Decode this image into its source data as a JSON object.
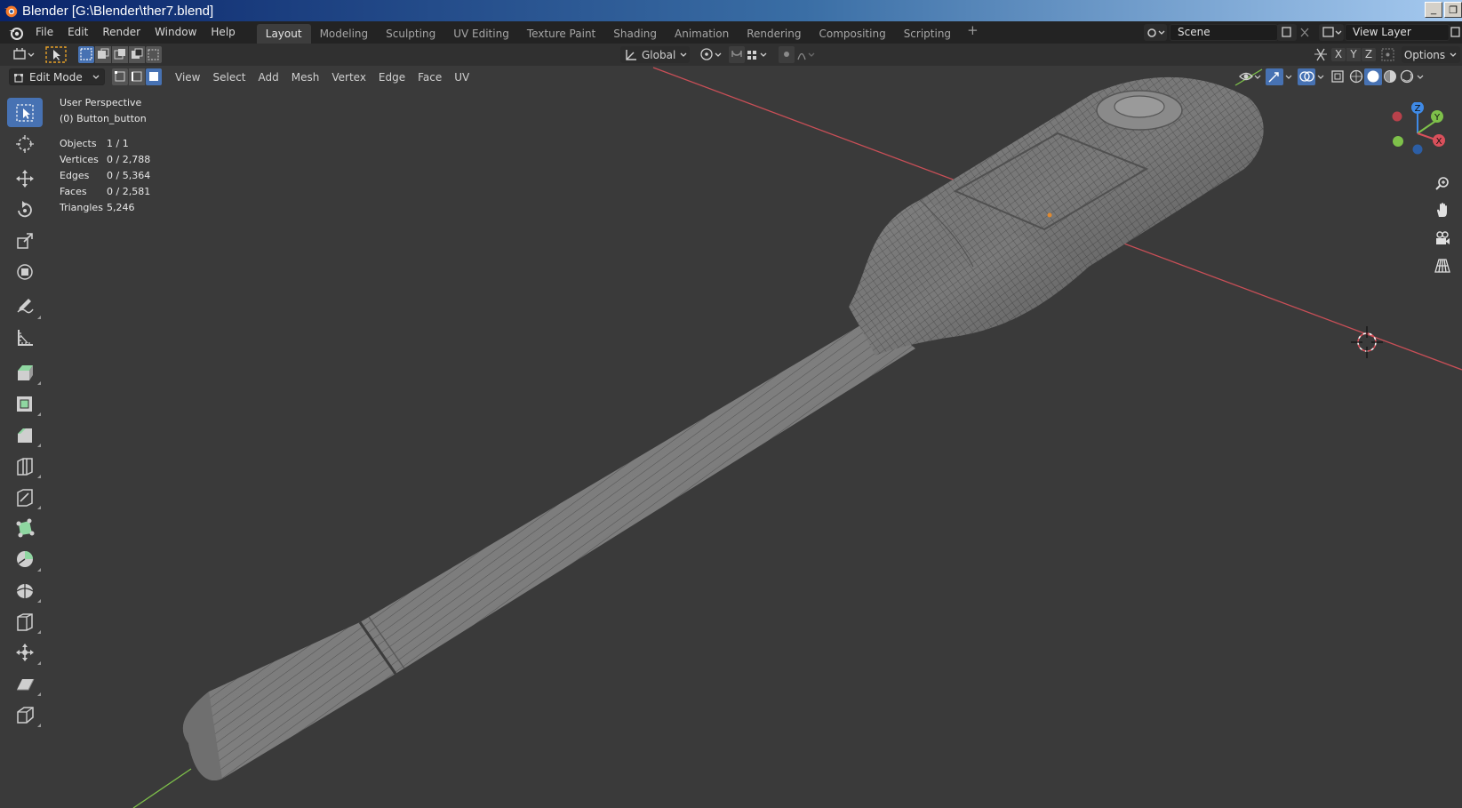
{
  "window": {
    "title": "Blender [G:\\Blender\\ther7.blend]",
    "buttons": [
      "_",
      "❐"
    ]
  },
  "menubar": {
    "items": [
      "File",
      "Edit",
      "Render",
      "Window",
      "Help"
    ]
  },
  "workspaces": {
    "tabs": [
      "Layout",
      "Modeling",
      "Sculpting",
      "UV Editing",
      "Texture Paint",
      "Shading",
      "Animation",
      "Rendering",
      "Compositing",
      "Scripting"
    ],
    "active": "Layout",
    "add": "+"
  },
  "scene": {
    "label": "Scene"
  },
  "view_layer": {
    "label": "View Layer"
  },
  "tool_header": {
    "transform_orientation": "Global",
    "options_label": "Options"
  },
  "axis_toggles": [
    "X",
    "Y",
    "Z"
  ],
  "viewport_header": {
    "mode": "Edit Mode",
    "menus": [
      "View",
      "Select",
      "Add",
      "Mesh",
      "Vertex",
      "Edge",
      "Face",
      "UV"
    ]
  },
  "overlay_text": {
    "perspective": "User Perspective",
    "object": "(0) Button_button",
    "stats": [
      {
        "label": "Objects",
        "value": "1 / 1"
      },
      {
        "label": "Vertices",
        "value": "0 / 2,788"
      },
      {
        "label": "Edges",
        "value": "0 / 5,364"
      },
      {
        "label": "Faces",
        "value": "0 / 2,581"
      },
      {
        "label": "Triangles",
        "value": "5,246"
      }
    ]
  },
  "gizmo": {
    "x": "X",
    "y": "Y",
    "z": "Z"
  },
  "tools": [
    "select-box-icon",
    "cursor-icon",
    "move-icon",
    "rotate-icon",
    "scale-icon",
    "transform-icon",
    "annotate-icon",
    "measure-icon",
    "extrude-icon",
    "inset-icon",
    "bevel-icon",
    "loop-cut-icon",
    "knife-icon",
    "poly-build-icon",
    "spin-icon",
    "smooth-icon",
    "edge-slide-icon",
    "shrink-fatten-icon",
    "shear-icon",
    "rip-icon"
  ],
  "colors": {
    "accent": "#4772b3",
    "x_axis": "#d9505b",
    "y_axis": "#7ec14a",
    "z_axis": "#3f8ae6",
    "viewport_bg": "#3a3a3a",
    "mesh": "#7d7d7d"
  }
}
